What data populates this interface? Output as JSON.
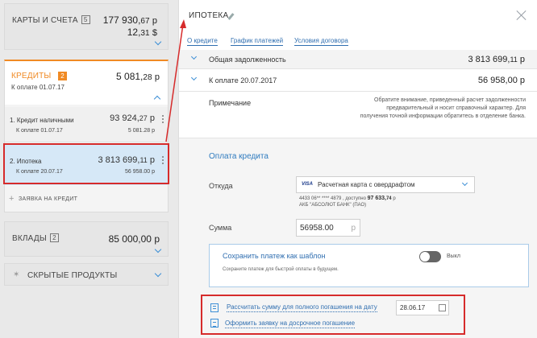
{
  "left": {
    "accounts": {
      "title": "КАРТЫ И СЧЕТА",
      "count": "5",
      "amount_main": "177 930,",
      "amount_kop": "67",
      "amount_cur": "р",
      "amount2_main": "12,",
      "amount2_kop": "31",
      "amount2_cur": "$"
    },
    "credits": {
      "title": "КРЕДИТЫ",
      "count": "2",
      "amount_main": "5 081,",
      "amount_kop": "28",
      "amount_cur": "р",
      "due_label": "К оплате 01.07.17",
      "items": [
        {
          "name": "1. Кредит наличными",
          "balance_main": "93 924,",
          "balance_kop": "27",
          "balance_cur": "р",
          "due_label": "К оплате 01.07.17",
          "due_amount": "5 081.28 р"
        },
        {
          "name": "2. Ипотека",
          "balance_main": "3 813 699,",
          "balance_kop": "11",
          "balance_cur": "р",
          "due_label": "К оплате 20.07.17",
          "due_amount": "56 958.00 р"
        }
      ],
      "request_label": "ЗАЯВКА НА КРЕДИТ"
    },
    "deposits": {
      "title": "ВКЛАДЫ",
      "count": "2",
      "amount": "85 000,00 р"
    },
    "hidden": {
      "title": "СКРЫТЫЕ ПРОДУКТЫ"
    }
  },
  "panel": {
    "title": "ИПОТЕКА",
    "tabs": [
      "О кредите",
      "График платежей",
      "Условия договора"
    ],
    "rows": {
      "debt_label": "Общая задолженность",
      "debt_main": "3 813 699,",
      "debt_kop": "11",
      "debt_cur": "р",
      "due_label": "К оплате 20.07.2017",
      "due_value": "56 958,00 р",
      "note_label": "Примечание",
      "note_text": "Обратите внимание, приведенный расчет задолженности предварительный и носит справочный характер. Для получения точной информации обратитесь в отделение банка."
    },
    "payment": {
      "title": "Оплата кредита",
      "from_label": "Откуда",
      "card_brand": "VISA",
      "card_name": "Расчетная карта с овердрафтом",
      "card_info_prefix": "4433 06** **** 4879 , доступно",
      "card_info_main": "97 633,",
      "card_info_kop": "74",
      "card_info_cur": "р",
      "bank_info": "АКБ \"АБСОЛЮТ БАНК\" (ПАО)",
      "sum_label": "Сумма",
      "sum_value": "56958.00",
      "sum_currency": "р",
      "template_title": "Сохранить платеж как шаблон",
      "template_desc": "Сохраните платеж для быстрой оплаты в будущем.",
      "toggle_label": "Выкл",
      "calc_link": "Рассчитать сумму для полного погашения на дату",
      "early_link": "Оформить заявку на досрочное погашение",
      "date_value": "28.06.17"
    }
  },
  "colors": {
    "accent_orange": "#f08a24",
    "link_blue": "#2f6eb0",
    "highlight_red": "#d62b2b",
    "selected_bg": "#d6e8f7"
  }
}
